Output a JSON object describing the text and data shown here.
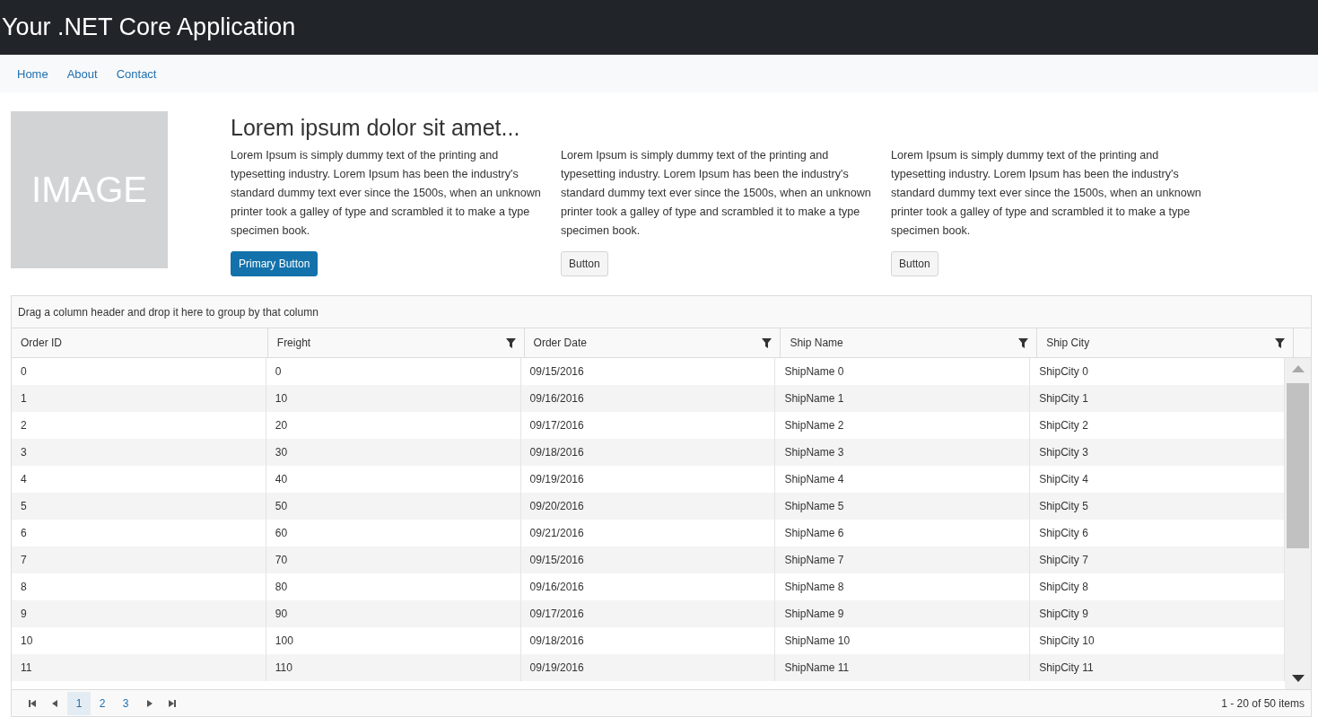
{
  "app_title": "Your .NET Core Application",
  "nav": [
    {
      "label": "Home"
    },
    {
      "label": "About"
    },
    {
      "label": "Contact"
    }
  ],
  "image_placeholder": "IMAGE",
  "heading": "Lorem ipsum dolor sit amet...",
  "features": [
    {
      "text": "Lorem Ipsum is simply dummy text of the printing and typesetting industry. Lorem Ipsum has been the industry's standard dummy text ever since the 1500s, when an unknown printer took a galley of type and scrambled it to make a type specimen book.",
      "button": "Primary Button",
      "kind": "primary"
    },
    {
      "text": "Lorem Ipsum is simply dummy text of the printing and typesetting industry. Lorem Ipsum has been the industry's standard dummy text ever since the 1500s, when an unknown printer took a galley of type and scrambled it to make a type specimen book.",
      "button": "Button",
      "kind": "default"
    },
    {
      "text": "Lorem Ipsum is simply dummy text of the printing and typesetting industry. Lorem Ipsum has been the industry's standard dummy text ever since the 1500s, when an unknown printer took a galley of type and scrambled it to make a type specimen book.",
      "button": "Button",
      "kind": "default"
    }
  ],
  "grid": {
    "group_hint": "Drag a column header and drop it here to group by that column",
    "columns": [
      {
        "label": "Order ID",
        "filter": false
      },
      {
        "label": "Freight",
        "filter": true
      },
      {
        "label": "Order Date",
        "filter": true
      },
      {
        "label": "Ship Name",
        "filter": true
      },
      {
        "label": "Ship City",
        "filter": true
      }
    ],
    "rows": [
      [
        "0",
        "0",
        "09/15/2016",
        "ShipName 0",
        "ShipCity 0"
      ],
      [
        "1",
        "10",
        "09/16/2016",
        "ShipName 1",
        "ShipCity 1"
      ],
      [
        "2",
        "20",
        "09/17/2016",
        "ShipName 2",
        "ShipCity 2"
      ],
      [
        "3",
        "30",
        "09/18/2016",
        "ShipName 3",
        "ShipCity 3"
      ],
      [
        "4",
        "40",
        "09/19/2016",
        "ShipName 4",
        "ShipCity 4"
      ],
      [
        "5",
        "50",
        "09/20/2016",
        "ShipName 5",
        "ShipCity 5"
      ],
      [
        "6",
        "60",
        "09/21/2016",
        "ShipName 6",
        "ShipCity 6"
      ],
      [
        "7",
        "70",
        "09/15/2016",
        "ShipName 7",
        "ShipCity 7"
      ],
      [
        "8",
        "80",
        "09/16/2016",
        "ShipName 8",
        "ShipCity 8"
      ],
      [
        "9",
        "90",
        "09/17/2016",
        "ShipName 9",
        "ShipCity 9"
      ],
      [
        "10",
        "100",
        "09/18/2016",
        "ShipName 10",
        "ShipCity 10"
      ],
      [
        "11",
        "110",
        "09/19/2016",
        "ShipName 11",
        "ShipCity 11"
      ]
    ],
    "pages": [
      {
        "label": "1",
        "selected": true
      },
      {
        "label": "2",
        "selected": false
      },
      {
        "label": "3",
        "selected": false
      }
    ],
    "pager_info": "1 - 20 of 50 items"
  }
}
